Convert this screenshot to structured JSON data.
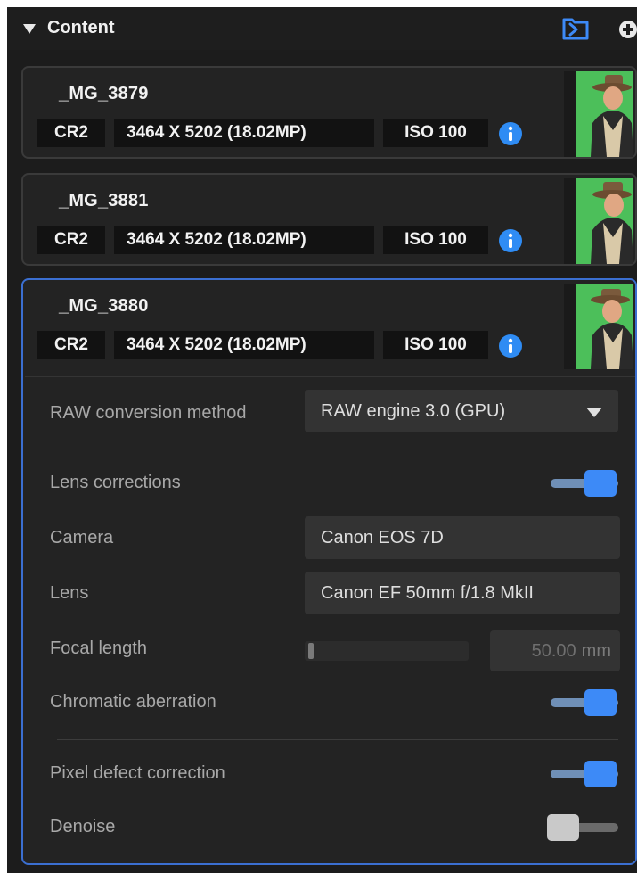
{
  "header": {
    "title": "Content"
  },
  "items": [
    {
      "name": "_MG_3879",
      "format": "CR2",
      "resolution": "3464 X 5202 (18.02MP)",
      "iso": "ISO 100"
    },
    {
      "name": "_MG_3881",
      "format": "CR2",
      "resolution": "3464 X 5202 (18.02MP)",
      "iso": "ISO 100"
    },
    {
      "name": "_MG_3880",
      "format": "CR2",
      "resolution": "3464 X 5202 (18.02MP)",
      "iso": "ISO 100"
    }
  ],
  "settings": {
    "raw_conversion": {
      "label": "RAW conversion method",
      "value": "RAW engine 3.0 (GPU)"
    },
    "lens_corrections": {
      "label": "Lens corrections",
      "on": true
    },
    "camera": {
      "label": "Camera",
      "value": "Canon EOS 7D"
    },
    "lens": {
      "label": "Lens",
      "value": "Canon EF 50mm f/1.8 MkII"
    },
    "focal_length": {
      "label": "Focal length",
      "value": "50.00",
      "unit": "mm",
      "slider_fraction": 0.0
    },
    "chromatic_aberration": {
      "label": "Chromatic aberration",
      "on": true
    },
    "pixel_defect": {
      "label": "Pixel defect correction",
      "on": true
    },
    "denoise": {
      "label": "Denoise",
      "on": false
    }
  },
  "colors": {
    "accent": "#3b6fd1",
    "toggle_on": "#3d8af7",
    "info": "#2f8cf4",
    "thumb_background": "#4cbf5a"
  },
  "icons": [
    "triangle-down-icon",
    "folder-link-icon",
    "plus-circle-icon",
    "info-icon"
  ]
}
